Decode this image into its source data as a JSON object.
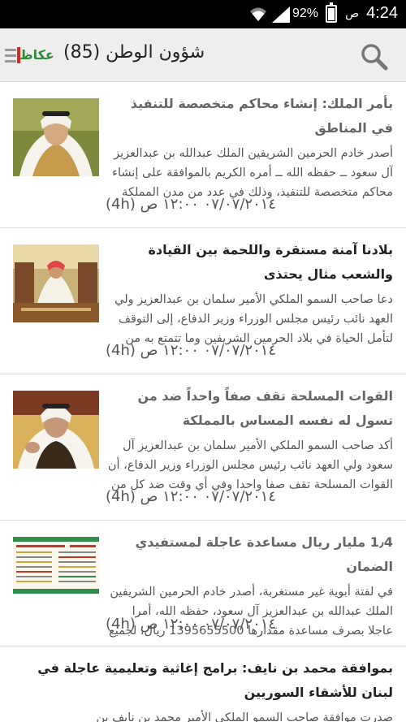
{
  "status_bar": {
    "time": "4:24",
    "ampm": "ص",
    "battery_percent": "92%",
    "battery_level": 0.92
  },
  "app_bar": {
    "logo_text": "عكاظ",
    "title": "شؤون الوطن (85)"
  },
  "articles": [
    {
      "headline": "بأمر الملك: إنشاء محاكم متخصصة للتنفيذ في المناطق",
      "snippet": "أصدر خادم الحرمين الشريفين الملك عبدالله بن عبدالعزيز آل سعود ــ حفظه الله ــ أمره الكريم بالموافقة على إنشاء محاكم متخصصة للتنفيذ، وذلك في عدد من مدن المملكة لرفع",
      "age": "(4h)",
      "date": "٠٧/٠٧/٢٠١٤ ١٢:٠٠ ص",
      "thumb": "king-portrait"
    },
    {
      "headline": "بلادنا آمنة مستقرة واللحمة بين القيادة والشعب مثال يحتذى",
      "snippet": "دعا صاحب السمو الملكي الأمير سلمان بن عبدالعزيز ولي العهد نائب رئيس مجلس الوزراء وزير الدفاع، إلى التوقف لتأمل الحياة في بلاد الحرمين الشريفين وما تتمتع به من أمن",
      "age": "(4h)",
      "date": "٠٧/٠٧/٢٠١٤ ١٢:٠٠ ص",
      "thumb": "majlis-photo"
    },
    {
      "headline": "القوات المسلحة تقف صفاً واحداً ضد من تسول له نفسه المساس بالمملكة",
      "snippet": "أكد صاحب السمو الملكي الأمير سلمان بن عبدالعزيز آل سعود ولي العهد نائب رئيس مجلس الوزراء وزير الدفاع، أن القوات المسلحة تقف صفا واحدا وفي أي وقت ضد كل من",
      "age": "(4h)",
      "date": "٠٧/٠٧/٢٠١٤ ١٢:٠٠ ص",
      "thumb": "prince-portrait"
    },
    {
      "headline": "1٫4 مليار ريال مساعدة عاجلة لمستفيدي الضمان",
      "snippet": "في لفتة أبوية غير مستغربة، أصدر خادم الحرمين الشريفين الملك عبدالله بن عبدالعزيز آل سعود، حفظه الله، أمرا عاجلا بصرف مساعدة مقدارها 1395655500 ريال، لجميع",
      "age": "(4h)",
      "date": "٠٧/٠٧/٢٠١٤ ١٢:٠٠ ص",
      "thumb": "infographic"
    },
    {
      "headline": "بموافقة محمد بن نايف: برامج إغاثية وتعليمية عاجلة في لبنان للأشقاء السوريين",
      "snippet": "صدرت موافقة صاحب السمو الملكي الأمير محمد بن نايف بن",
      "age": "",
      "date": "",
      "thumb": ""
    }
  ],
  "colors": {
    "status_bar_bg": "#000000",
    "app_bar_bg": "#eeeeee",
    "logo_green": "#2e8b3a",
    "logo_red": "#d9281c"
  }
}
